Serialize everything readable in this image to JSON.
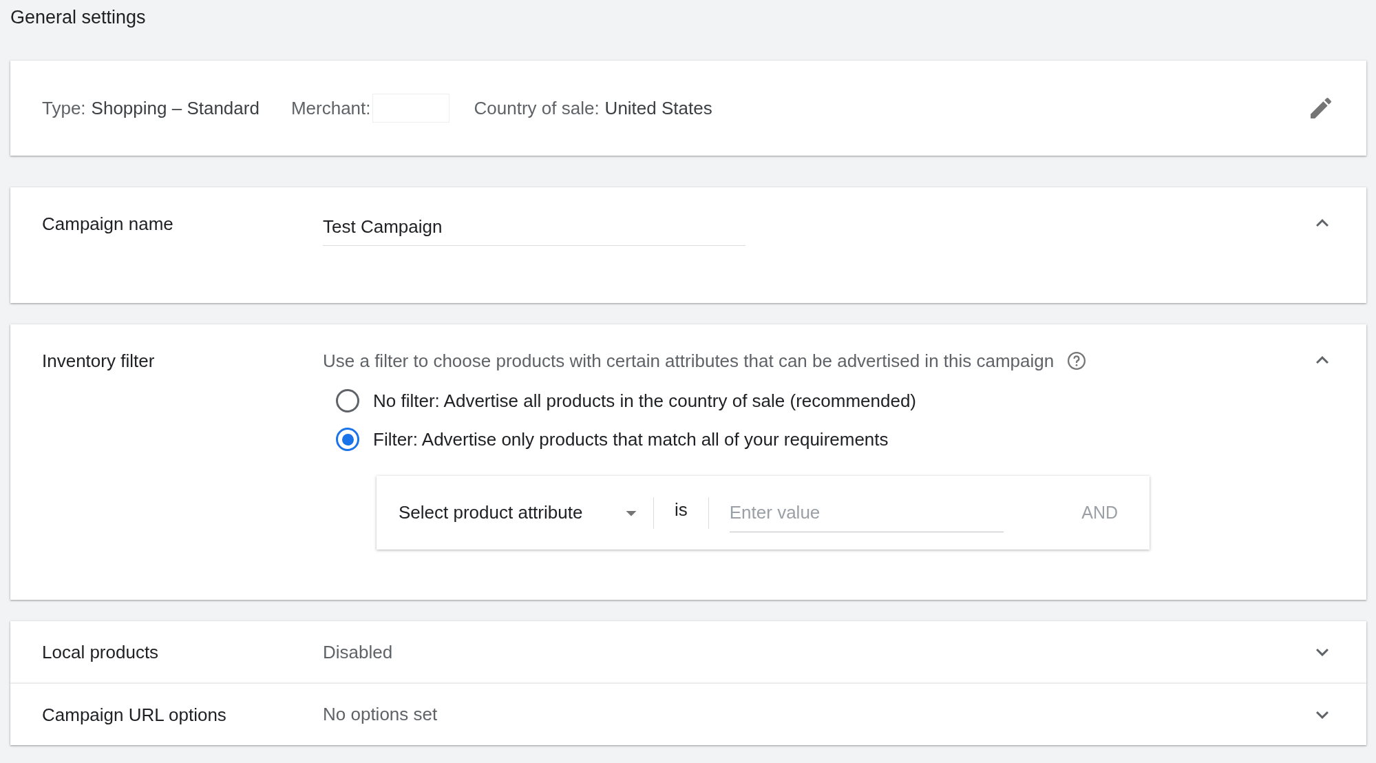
{
  "page_title": "General settings",
  "summary": {
    "items": [
      {
        "kind": "text",
        "label": "Type:",
        "value": "Shopping – Standard"
      },
      {
        "kind": "blank",
        "label": "Merchant:"
      },
      {
        "kind": "text",
        "label": "Country of sale:",
        "value": "United States"
      }
    ]
  },
  "sections": [
    {
      "kind": "text-field",
      "label": "Campaign name",
      "value": "Test Campaign",
      "expanded": true
    },
    {
      "kind": "filter",
      "label": "Inventory filter",
      "description": "Use a filter to choose products with certain attributes that can be advertised in this campaign",
      "expanded": true,
      "options": [
        {
          "label": "No filter: Advertise all products in the country of sale (recommended)",
          "selected": false
        },
        {
          "label": "Filter: Advertise only products that match all of your requirements",
          "selected": true
        }
      ],
      "filter_row": {
        "attribute": "Select product attribute",
        "operator": "is",
        "value_placeholder": "Enter value",
        "and_button": "AND"
      }
    },
    {
      "kind": "summary",
      "label": "Local products",
      "summary": "Disabled",
      "expanded": false
    },
    {
      "kind": "summary",
      "label": "Campaign URL options",
      "summary": "No options set",
      "expanded": false
    }
  ]
}
